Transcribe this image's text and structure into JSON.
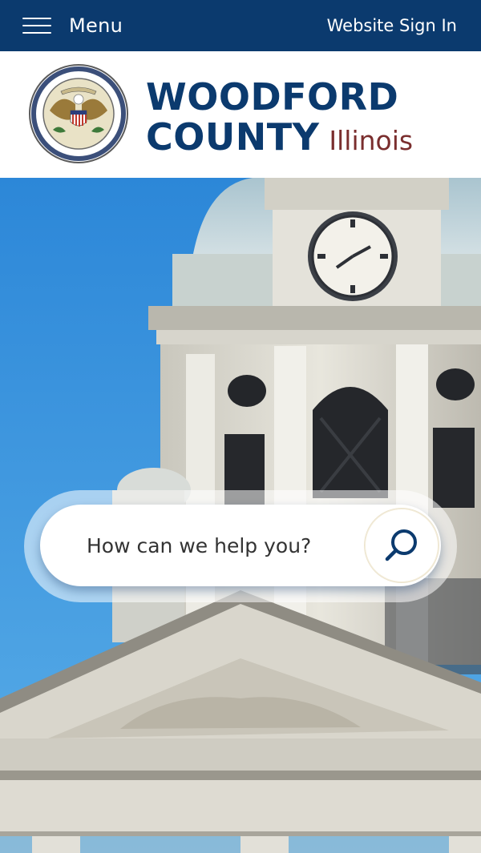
{
  "topbar": {
    "menu_label": "Menu",
    "signin_label": "Website Sign In"
  },
  "logo": {
    "line1": "WOODFORD",
    "line2": "COUNTY",
    "state": "Illinois"
  },
  "search": {
    "placeholder": "How can we help you?"
  },
  "colors": {
    "navy": "#0b3a6e",
    "maroon": "#7a2e2e",
    "sky": "#2f8fdc"
  },
  "icons": {
    "menu": "hamburger-icon",
    "search": "search-icon",
    "seal": "county-seal"
  }
}
